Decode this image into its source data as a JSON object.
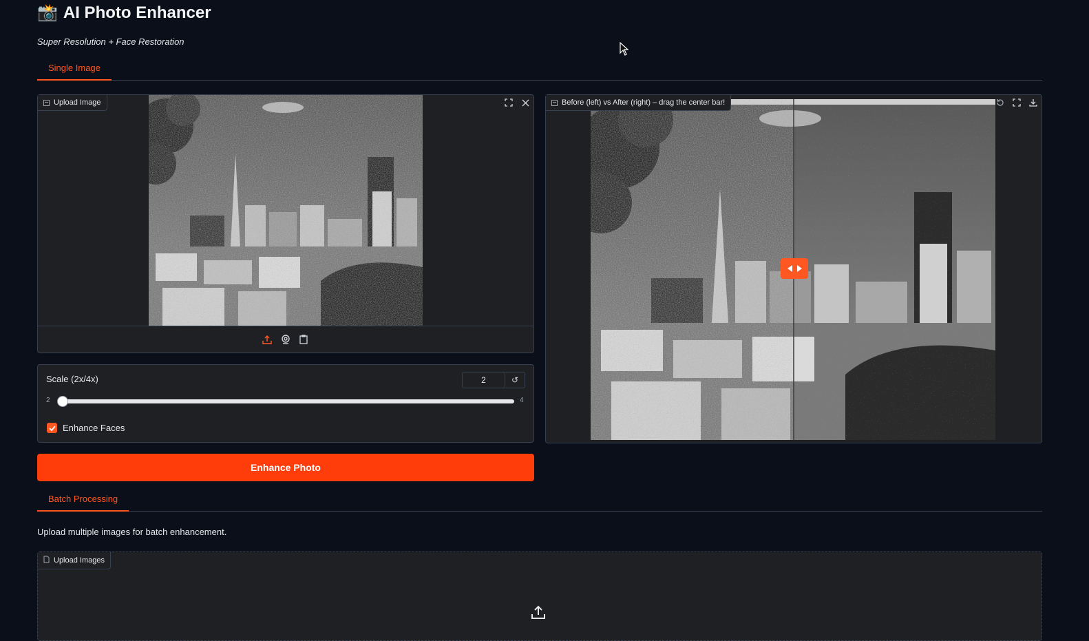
{
  "header": {
    "title": "AI Photo Enhancer",
    "title_emoji": "📸",
    "subtitle": "Super Resolution + Face Restoration"
  },
  "tabs": {
    "single": "Single Image",
    "batch": "Batch Processing"
  },
  "upload_panel": {
    "label": "Upload Image",
    "icons": [
      "fullscreen-icon",
      "close-icon",
      "upload-icon",
      "webcam-icon",
      "clipboard-icon"
    ]
  },
  "compare_panel": {
    "label": "Before (left) vs After (right) – drag the center bar!",
    "icons": [
      "reset-icon",
      "fullscreen-icon",
      "download-icon",
      "drag-handle-icon"
    ]
  },
  "controls": {
    "scale_label": "Scale (2x/4x)",
    "scale_value": "2",
    "scale_min": "2",
    "scale_max": "4",
    "scale_fraction": 0.0,
    "enhance_faces_label": "Enhance Faces",
    "enhance_faces_checked": true
  },
  "actions": {
    "enhance_button": "Enhance Photo"
  },
  "batch": {
    "description": "Upload multiple images for batch enhancement.",
    "upload_label": "Upload Images"
  },
  "colors": {
    "accent": "#ff5722",
    "button": "#ff3d0a",
    "background": "#0b0f19",
    "panel": "#1f2023"
  }
}
